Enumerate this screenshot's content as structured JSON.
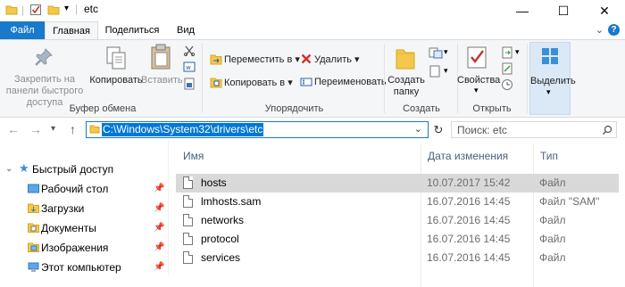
{
  "window": {
    "title": "etc"
  },
  "tabs": {
    "file": "Файл",
    "home": "Главная",
    "share": "Поделиться",
    "view": "Вид"
  },
  "ribbon": {
    "clipboard": {
      "pin_label": "Закрепить на панели быстрого доступа",
      "copy_label": "Копировать",
      "paste_label": "Вставить",
      "group_label": "Буфер обмена"
    },
    "organize": {
      "move_to": "Переместить в",
      "copy_to": "Копировать в",
      "delete": "Удалить",
      "rename": "Переименовать",
      "group_label": "Упорядочить"
    },
    "new": {
      "new_folder": "Создать папку",
      "group_label": "Создать"
    },
    "open": {
      "properties": "Свойства",
      "group_label": "Открыть"
    },
    "select": {
      "select_label": "Выделить"
    }
  },
  "address": {
    "path": "C:\\Windows\\System32\\drivers\\etc"
  },
  "search": {
    "placeholder": "Поиск: etc"
  },
  "nav": [
    {
      "label": "Быстрый доступ",
      "icon": "star-icon",
      "pinned": false
    },
    {
      "label": "Рабочий стол",
      "icon": "desktop-folder-icon",
      "pinned": true
    },
    {
      "label": "Загрузки",
      "icon": "downloads-folder-icon",
      "pinned": true
    },
    {
      "label": "Документы",
      "icon": "documents-folder-icon",
      "pinned": true
    },
    {
      "label": "Изображения",
      "icon": "pictures-folder-icon",
      "pinned": true
    },
    {
      "label": "Этот компьютер",
      "icon": "computer-icon",
      "pinned": true
    }
  ],
  "columns": {
    "name": "Имя",
    "date": "Дата изменения",
    "type": "Тип"
  },
  "files": [
    {
      "name": "hosts",
      "date": "10.07.2017 15:42",
      "type": "Файл",
      "selected": true
    },
    {
      "name": "lmhosts.sam",
      "date": "16.07.2016 14:45",
      "type": "Файл \"SAM\"",
      "selected": false
    },
    {
      "name": "networks",
      "date": "16.07.2016 14:45",
      "type": "Файл",
      "selected": false
    },
    {
      "name": "protocol",
      "date": "16.07.2016 14:45",
      "type": "Файл",
      "selected": false
    },
    {
      "name": "services",
      "date": "16.07.2016 14:45",
      "type": "Файл",
      "selected": false
    }
  ],
  "colors": {
    "accent": "#1979ca",
    "selection": "#d9d9d9",
    "address_highlight": "#0078d7"
  }
}
